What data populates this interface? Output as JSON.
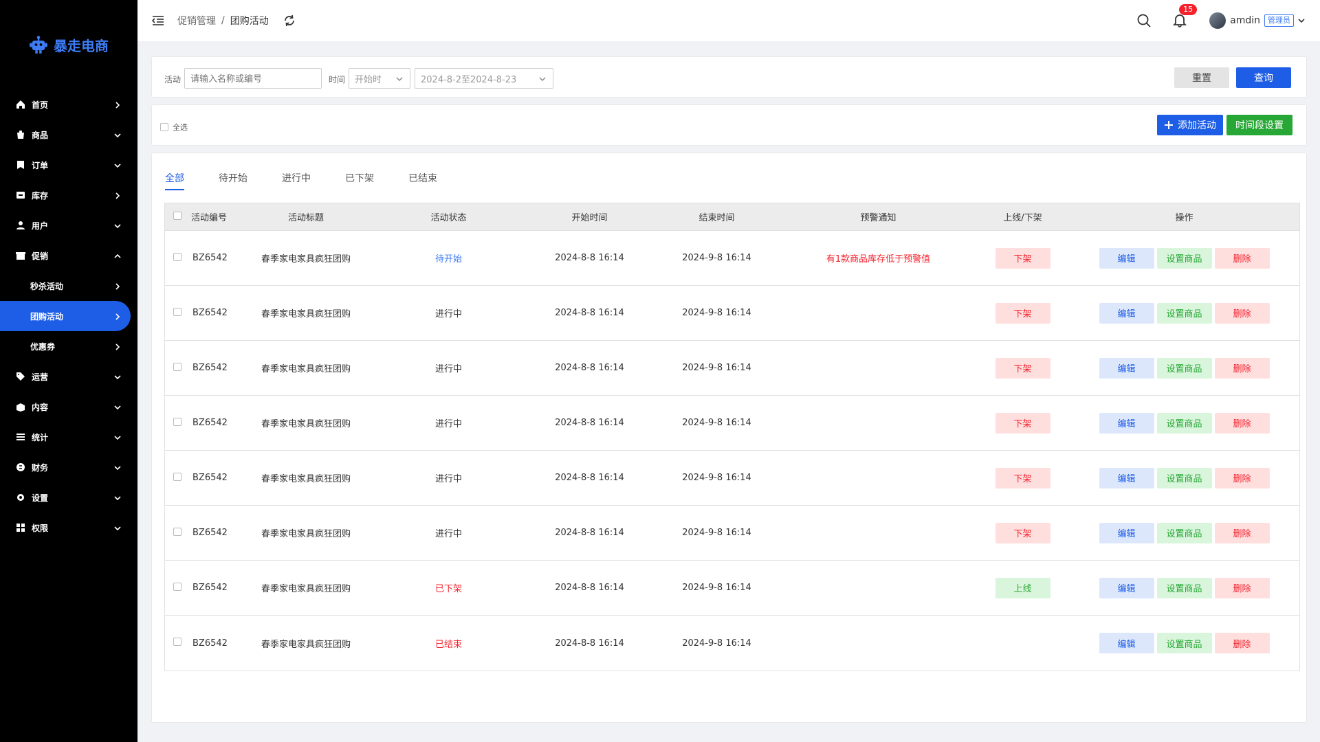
{
  "brand": {
    "name": "暴走电商"
  },
  "sidebar": {
    "items": [
      {
        "label": "首页",
        "icon": "home-icon",
        "chevron": "right"
      },
      {
        "label": "商品",
        "icon": "goods-icon",
        "chevron": "down"
      },
      {
        "label": "订单",
        "icon": "order-icon",
        "chevron": "down"
      },
      {
        "label": "库存",
        "icon": "inventory-icon",
        "chevron": "right"
      },
      {
        "label": "用户",
        "icon": "user-icon",
        "chevron": "down"
      },
      {
        "label": "促销",
        "icon": "promotion-icon",
        "chevron": "up"
      },
      {
        "label": "秒杀活动",
        "sub": true,
        "chevron": "right"
      },
      {
        "label": "团购活动",
        "sub": true,
        "active": true,
        "chevron": "right"
      },
      {
        "label": "优惠券",
        "sub": true,
        "chevron": "right"
      },
      {
        "label": "运营",
        "icon": "tag-icon",
        "chevron": "down"
      },
      {
        "label": "内容",
        "icon": "content-icon",
        "chevron": "down"
      },
      {
        "label": "统计",
        "icon": "stats-icon",
        "chevron": "down"
      },
      {
        "label": "财务",
        "icon": "finance-icon",
        "chevron": "down"
      },
      {
        "label": "设置",
        "icon": "gear-icon",
        "chevron": "down"
      },
      {
        "label": "权限",
        "icon": "permission-icon",
        "chevron": "down"
      }
    ]
  },
  "header": {
    "breadcrumb": [
      "促销管理",
      "团购活动"
    ],
    "notification_count": "15",
    "username": "amdin",
    "role": "管理员"
  },
  "filters": {
    "activity_label": "活动",
    "activity_placeholder": "请输入名称或编号",
    "time_label": "时间",
    "time_type": "开始时",
    "date_range": "2024-8-2至2024-8-23",
    "reset": "重置",
    "query": "查询"
  },
  "selection": {
    "select_all": "全选",
    "add_activity": "添加活动",
    "period_setting": "时间段设置"
  },
  "tabs": [
    "全部",
    "待开始",
    "进行中",
    "已下架",
    "已结束"
  ],
  "table": {
    "headers": [
      "活动编号",
      "活动标题",
      "活动状态",
      "开始时间",
      "结束时间",
      "预警通知",
      "上线/下架",
      "操作"
    ],
    "ops": {
      "edit": "编辑",
      "set_goods": "设置商品",
      "delete": "删除"
    },
    "rows": [
      {
        "id": "BZ6542",
        "title": "春季家电家具疯狂团购",
        "status": "待开始",
        "status_color": "blue",
        "start": "2024-8-8 16:14",
        "end": "2024-9-8 16:14",
        "warn": "有1款商品库存低于预警值",
        "toggle": "下架",
        "toggle_type": "off"
      },
      {
        "id": "BZ6542",
        "title": "春季家电家具疯狂团购",
        "status": "进行中",
        "status_color": "default",
        "start": "2024-8-8 16:14",
        "end": "2024-9-8 16:14",
        "warn": "",
        "toggle": "下架",
        "toggle_type": "off"
      },
      {
        "id": "BZ6542",
        "title": "春季家电家具疯狂团购",
        "status": "进行中",
        "status_color": "default",
        "start": "2024-8-8 16:14",
        "end": "2024-9-8 16:14",
        "warn": "",
        "toggle": "下架",
        "toggle_type": "off"
      },
      {
        "id": "BZ6542",
        "title": "春季家电家具疯狂团购",
        "status": "进行中",
        "status_color": "default",
        "start": "2024-8-8 16:14",
        "end": "2024-9-8 16:14",
        "warn": "",
        "toggle": "下架",
        "toggle_type": "off"
      },
      {
        "id": "BZ6542",
        "title": "春季家电家具疯狂团购",
        "status": "进行中",
        "status_color": "default",
        "start": "2024-8-8 16:14",
        "end": "2024-9-8 16:14",
        "warn": "",
        "toggle": "下架",
        "toggle_type": "off"
      },
      {
        "id": "BZ6542",
        "title": "春季家电家具疯狂团购",
        "status": "进行中",
        "status_color": "default",
        "start": "2024-8-8 16:14",
        "end": "2024-9-8 16:14",
        "warn": "",
        "toggle": "下架",
        "toggle_type": "off"
      },
      {
        "id": "BZ6542",
        "title": "春季家电家具疯狂团购",
        "status": "已下架",
        "status_color": "red",
        "start": "2024-8-8 16:14",
        "end": "2024-9-8 16:14",
        "warn": "",
        "toggle": "上线",
        "toggle_type": "on"
      },
      {
        "id": "BZ6542",
        "title": "春季家电家具疯狂团购",
        "status": "已结束",
        "status_color": "red",
        "start": "2024-8-8 16:14",
        "end": "2024-9-8 16:14",
        "warn": "",
        "toggle": "",
        "toggle_type": "none"
      }
    ]
  },
  "colors": {
    "primary": "#1e5ee6",
    "success": "#27a735",
    "danger": "#f5222d",
    "sidebar_bg": "#000000"
  }
}
